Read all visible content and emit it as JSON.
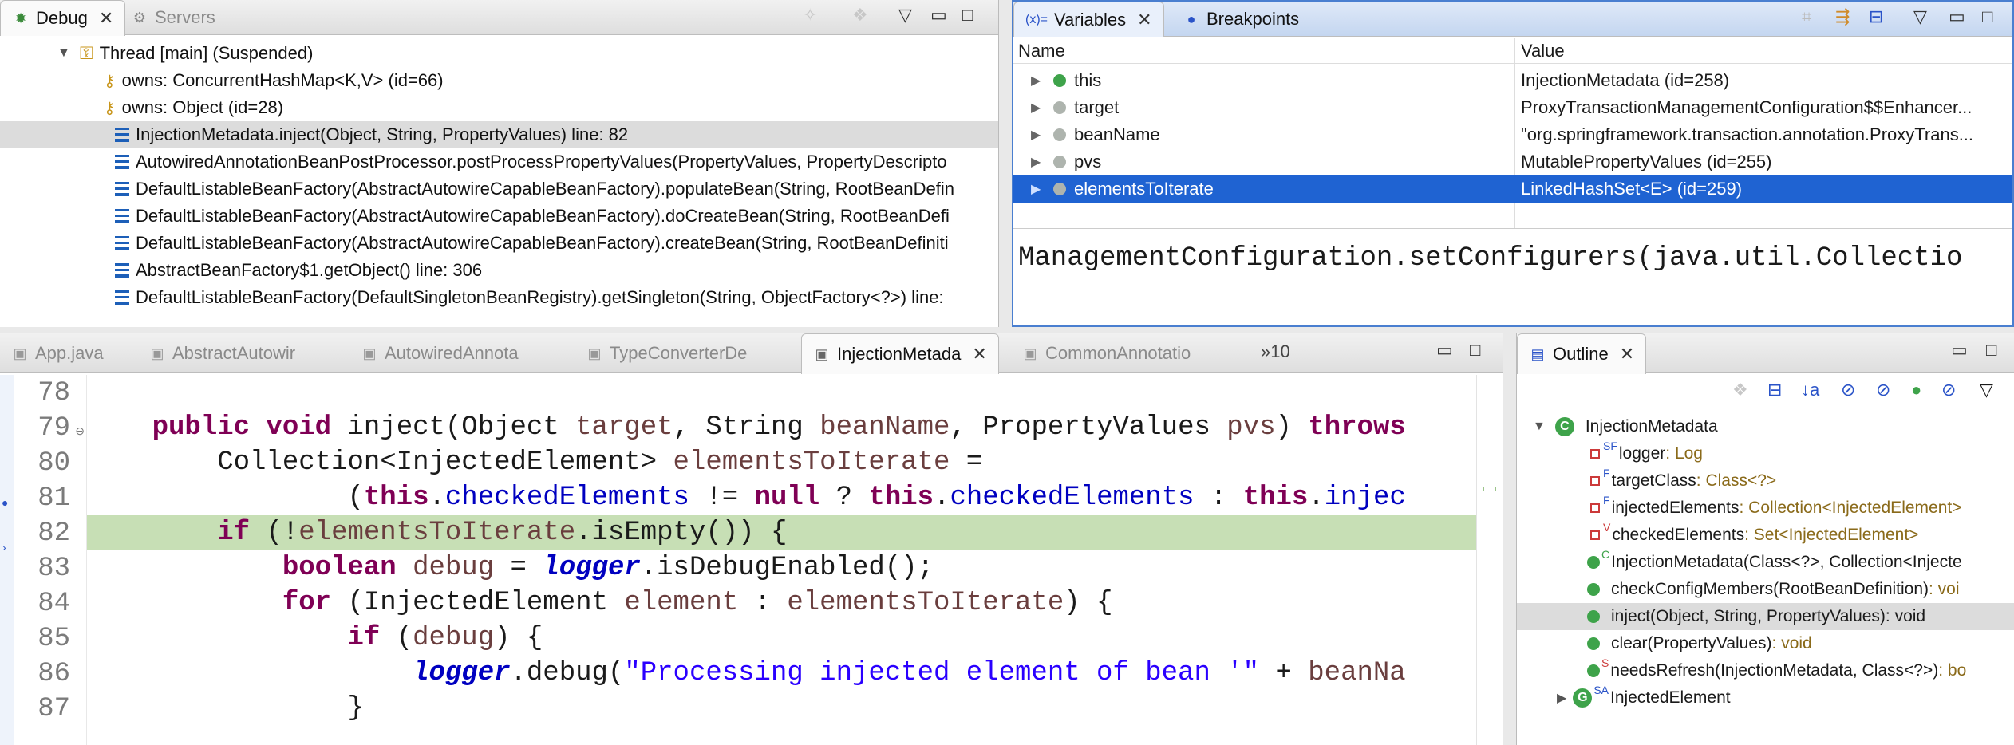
{
  "debug": {
    "tabs": [
      {
        "label": "Debug"
      },
      {
        "label": "Servers"
      }
    ],
    "tree": [
      {
        "label": "Thread [main] (Suspended)"
      },
      {
        "label": "owns: ConcurrentHashMap<K,V>  (id=66)"
      },
      {
        "label": "owns: Object  (id=28)"
      },
      {
        "label": "InjectionMetadata.inject(Object, String, PropertyValues) line: 82"
      },
      {
        "label": "AutowiredAnnotationBeanPostProcessor.postProcessPropertyValues(PropertyValues, PropertyDescripto"
      },
      {
        "label": "DefaultListableBeanFactory(AbstractAutowireCapableBeanFactory).populateBean(String, RootBeanDefin"
      },
      {
        "label": "DefaultListableBeanFactory(AbstractAutowireCapableBeanFactory).doCreateBean(String, RootBeanDefi"
      },
      {
        "label": "DefaultListableBeanFactory(AbstractAutowireCapableBeanFactory).createBean(String, RootBeanDefiniti"
      },
      {
        "label": "AbstractBeanFactory$1.getObject() line: 306"
      },
      {
        "label": "DefaultListableBeanFactory(DefaultSingletonBeanRegistry).getSingleton(String, ObjectFactory<?>) line:"
      }
    ]
  },
  "variables": {
    "tabs": [
      {
        "label": "Variables"
      },
      {
        "label": "Breakpoints"
      }
    ],
    "tab_prefix": "(x)=",
    "columns": {
      "name": "Name",
      "value": "Value"
    },
    "rows": [
      {
        "name": "this",
        "value": "InjectionMetadata  (id=258)"
      },
      {
        "name": "target",
        "value": "ProxyTransactionManagementConfiguration$$Enhancer..."
      },
      {
        "name": "beanName",
        "value": "\"org.springframework.transaction.annotation.ProxyTrans..."
      },
      {
        "name": "pvs",
        "value": "MutablePropertyValues  (id=255)"
      },
      {
        "name": "elementsToIterate",
        "value": "LinkedHashSet<E>  (id=259)"
      }
    ],
    "detail_text": "ManagementConfiguration.setConfigurers(java.util.Collectio"
  },
  "editor": {
    "tabs": [
      {
        "label": "App.java"
      },
      {
        "label": "AbstractAutowir"
      },
      {
        "label": "AutowiredAnnota"
      },
      {
        "label": "TypeConverterDe"
      },
      {
        "label": "InjectionMetada"
      },
      {
        "label": "CommonAnnotatio"
      }
    ],
    "overflow_label": "»10",
    "line_numbers": [
      "78",
      "79",
      "80",
      "81",
      "82",
      "83",
      "84",
      "85",
      "86",
      "87"
    ]
  },
  "outline": {
    "tab_label": "Outline",
    "items": [
      {
        "name": "InjectionMetadata",
        "type": ""
      },
      {
        "name": "logger",
        "type": " : Log"
      },
      {
        "name": "targetClass",
        "type": " : Class<?>"
      },
      {
        "name": "injectedElements",
        "type": " : Collection<InjectedElement>"
      },
      {
        "name": "checkedElements",
        "type": " : Set<InjectedElement>"
      },
      {
        "name": "InjectionMetadata(Class<?>, Collection<Injecte",
        "type": ""
      },
      {
        "name": "checkConfigMembers(RootBeanDefinition)",
        "type": " : voi"
      },
      {
        "name": "inject(Object, String, PropertyValues)",
        "type": " : void"
      },
      {
        "name": "clear(PropertyValues)",
        "type": " : void"
      },
      {
        "name": "needsRefresh(InjectionMetadata, Class<?>)",
        "type": " : bo"
      },
      {
        "name": "InjectedElement",
        "type": ""
      }
    ]
  }
}
